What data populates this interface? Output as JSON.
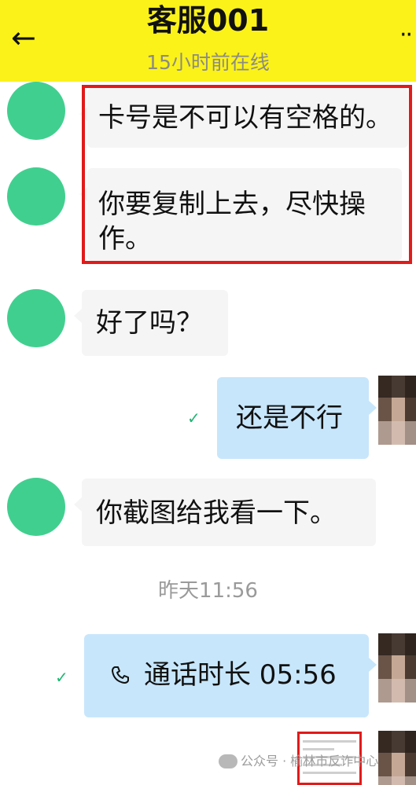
{
  "header": {
    "title": "客服001",
    "subtitle": "15小时前在线",
    "back_icon": "←",
    "more_icon": "··"
  },
  "colors": {
    "header_bg": "#fbf21a",
    "avatar_green": "#41cf8f",
    "outgoing_bubble": "#c7e6fb",
    "incoming_bubble": "#f5f5f5",
    "highlight_red": "#e11a1a",
    "read_check": "#22b573"
  },
  "avatar_glyph": "",
  "messages": [
    {
      "text": "卡号是不可以有空格的。"
    },
    {
      "text": "你要复制上去，尽快操作。"
    },
    {
      "text": "好了吗？"
    },
    {
      "text": "还是不行"
    },
    {
      "text": "你截图给我看一下。"
    }
  ],
  "timestamp": "昨天11:56",
  "call": {
    "icon": "phone-icon",
    "label": "通话时长 05:56"
  },
  "read_receipt_icon": "✓",
  "watermark": {
    "text": "公众号 · 榆林市反诈中心"
  }
}
